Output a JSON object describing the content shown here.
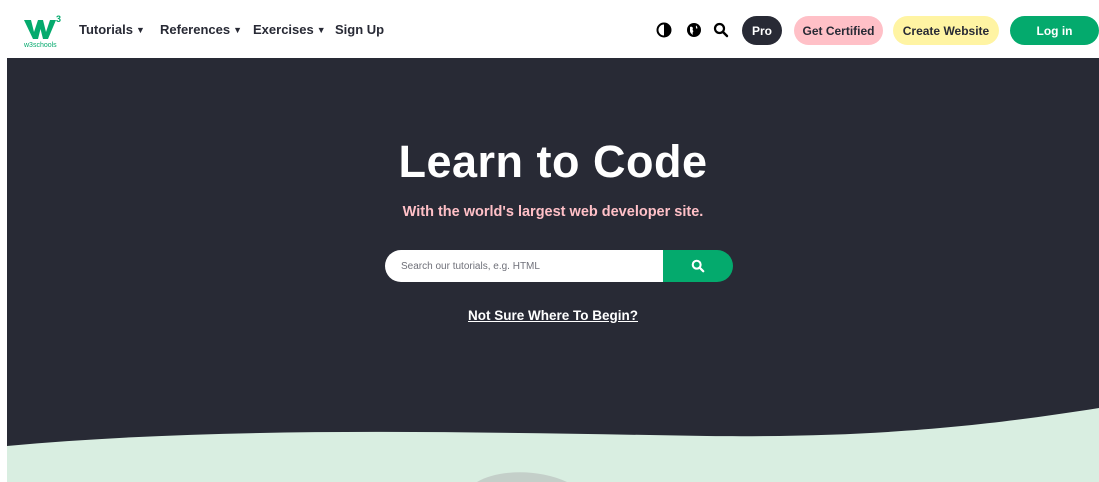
{
  "brand": {
    "name": "w3schools",
    "sup": "3",
    "accent": "#04aa6d"
  },
  "nav": {
    "tutorials": "Tutorials",
    "references": "References",
    "exercises": "Exercises",
    "signup": "Sign Up",
    "caret": "▼"
  },
  "icons": [
    "contrast-icon",
    "globe-icon",
    "search-icon"
  ],
  "buttons": {
    "pro": "Pro",
    "get_certified": "Get Certified",
    "create_website": "Create Website",
    "login": "Log in"
  },
  "hero": {
    "title": "Learn to Code",
    "subtitle": "With the world's largest web developer site.",
    "search_placeholder": "Search our tutorials, e.g. HTML",
    "begin_link": "Not Sure Where To Begin?"
  },
  "colors": {
    "hero_bg": "#282a35",
    "green": "#04aa6d",
    "pink": "#ffc0c7",
    "yellow": "#fff4a3",
    "mint": "#d9eee1"
  }
}
